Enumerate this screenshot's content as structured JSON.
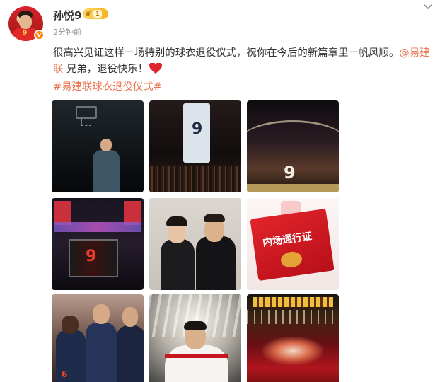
{
  "post": {
    "author": {
      "name": "孙悦9",
      "member_level": "1",
      "verified_badge": "V"
    },
    "timestamp": "2分钟前",
    "content": {
      "text_part1": "很高兴见证这样一场特别的球衣退役仪式，祝你在今后的新篇章里一帆风顺。",
      "mention": "@易建联",
      "text_part2": " 兄弟，退役快乐！",
      "hashtag": "#易建联球衣退役仪式#"
    },
    "images": [
      {
        "icon": "photo-stage-speech"
      },
      {
        "icon": "photo-jersey-hanging",
        "overlay_text": "9"
      },
      {
        "icon": "photo-arena-stage",
        "overlay_text": "9"
      },
      {
        "icon": "photo-jumbotron",
        "overlay_text": "9"
      },
      {
        "icon": "photo-two-men"
      },
      {
        "icon": "photo-pass-card",
        "overlay_text": "内场通行证"
      },
      {
        "icon": "photo-players-huddle",
        "overlay_text": "6"
      },
      {
        "icon": "photo-player-celebrating"
      },
      {
        "icon": "photo-arena-crowd"
      }
    ]
  },
  "colors": {
    "accent_link": "#eb7350",
    "text": "#333333",
    "meta": "#939393",
    "heart": "#e0262d",
    "vip_gold": "#f6b21f"
  }
}
